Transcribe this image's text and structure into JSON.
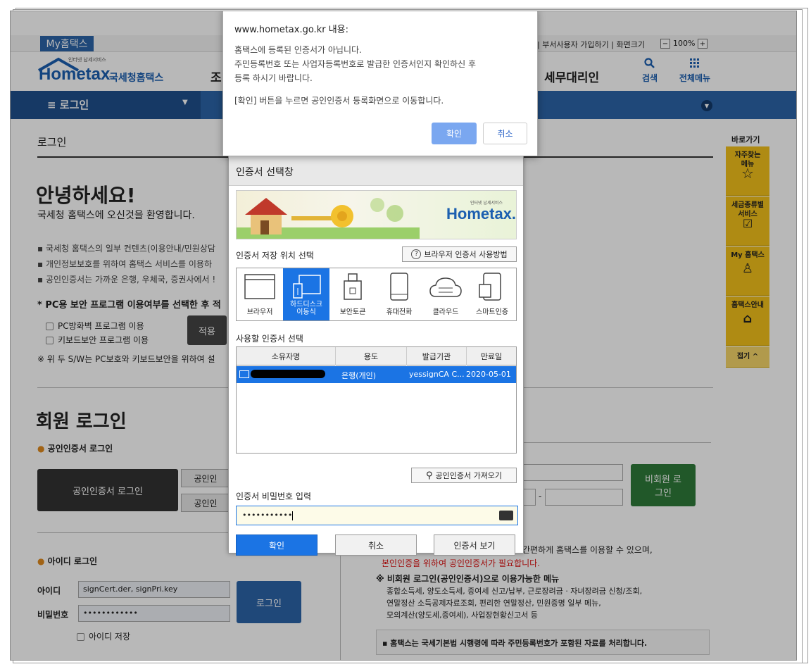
{
  "browser_alert": {
    "origin": "www.hometax.go.kr 내용:",
    "line1": "홈택스에 등록된 인증서가 아닙니다.",
    "line2": "주민등록번호 또는 사업자등록번호로 발급한 인증서인지 확인하신 후",
    "line3": "등록 하시기 바랍니다.",
    "line4": "[확인] 버튼을 누르면 공인인증서 등록화면으로 이동합니다.",
    "ok": "확인",
    "cancel": "취소"
  },
  "header": {
    "myhometax": "My홈택스",
    "top_links": "| 부서사용자 가입하기 | 화면크기",
    "zoom": "100%",
    "zoom_minus": "−",
    "zoom_plus": "+",
    "logo_tagline": "인터넷 납세서비스",
    "logo_text": "Hometax",
    "logo_sub": "국세청홈택스",
    "nav_partial": "조",
    "nav_tax_agent": "세무대리인",
    "search": "검색",
    "all_menu": "전체메뉴"
  },
  "bluebar": {
    "menu_label": "≡ 로그인"
  },
  "left": {
    "breadcrumb": "로그인",
    "hello": "안녕하세요!",
    "welcome": "국세청 홈택스에 오신것을 환영합니다.",
    "bullets": [
      "국세청 홈택스의 일부 컨텐츠(이용안내/민원상담",
      "개인정보보호를 위하여 홈택스 서비스를 이용하",
      "공인인증서는 가까운 은행, 우체국, 증권사에서 !"
    ],
    "pc_title": "* PC용 보안 프로그램 이용여부를 선택한 후 적",
    "firewall": "PC방화벽 프로그램 이용",
    "keyboard": "키보드보안 프로그램 이용",
    "apply": "적용",
    "sw_note": "※ 위 두 S/W는 PC보호와 키보드보안을 위하여 설",
    "member_login": "회원 로그인",
    "cert_login_label": "공인인증서 로그인",
    "cert_login_btn": "공인인증서 로그인",
    "side_btn1": "공인인",
    "side_btn2": "공인인",
    "id_login_label": "아이디 로그인",
    "id_label": "아이디",
    "id_value": "signCert.der, signPri.key",
    "pw_label": "비밀번호",
    "pw_value": "••••••••••••",
    "login_btn": "로그인",
    "save_id": "아이디 저장"
  },
  "right": {
    "nonmember_btn": "비회원 로그인",
    "dash": "-",
    "info1": "간편하게 홈택스를 이용할 수 있으며,",
    "info2": "본인인증을 위하여 공인인증서가 필요합니다.",
    "member_title": "※ 비회원 로그인(공인인증서)으로 이용가능한 메뉴",
    "member_line1": "종합소득세, 양도소득세, 증여세 신고/납부, 근로장려금 · 자녀장려금 신청/조회,",
    "member_line2": "연말정산 소득공제자료조회, 편리한 연말정산, 민원증명 일부 메뉴,",
    "member_line3": "모의계산(양도세,증여세), 사업장현황신고서 등",
    "notice": "▪ 홈택스는 국세기본법 시행령에 따라 주민등록번호가 포함된 자료를 처리합니다."
  },
  "quick": {
    "title": "바로가기",
    "items": [
      "자주찾는 메뉴",
      "세금종류별 서비스",
      "My 홈택스",
      "홈택스안내"
    ],
    "close": "접기 ^"
  },
  "cert_dialog": {
    "title": "인증서 선택창",
    "banner_tagline": "인터넷 납세서비스",
    "banner_logo": "Hometax.",
    "storage_label": "인증서 저장 위치 선택",
    "browser_help": "브라우저 인증서 사용방법",
    "tabs": [
      "브라우저",
      "하드디스크 이동식",
      "보안토큰",
      "휴대전화",
      "클라우드",
      "스마트인증"
    ],
    "select_label": "사용할 인증서 선택",
    "columns": [
      "소유자명",
      "용도",
      "발급기관",
      "만료일"
    ],
    "row": {
      "usage": "은행(개인)",
      "issuer": "yessignCA C...",
      "expiry": "2020-05-01"
    },
    "import_btn": "공인인증서 가져오기",
    "pw_label": "인증서 비밀번호 입력",
    "pw_value": "•••••••••••",
    "ok": "확인",
    "cancel": "취소",
    "view": "인증서 보기"
  },
  "colors": {
    "blue": "#1b74e4",
    "nav_blue": "#2b64a8",
    "yellow": "#f3c11b",
    "green": "#2f7a3a"
  }
}
